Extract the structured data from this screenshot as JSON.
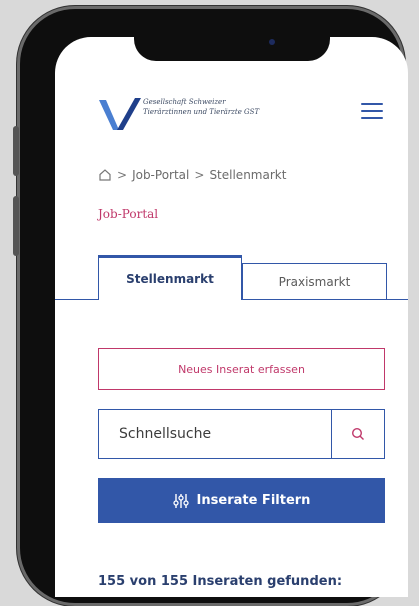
{
  "header": {
    "org_line1": "Gesellschaft Schweizer",
    "org_line2": "Tierärztinnen und Tierärzte GST",
    "logo_icon": "gst-v-logo",
    "menu_icon": "hamburger-menu-icon"
  },
  "breadcrumb": {
    "home_icon": "home-icon",
    "sep": ">",
    "items": [
      "Job-Portal",
      "Stellenmarkt"
    ]
  },
  "page_title": "Job-Portal",
  "tabs": [
    {
      "label": "Stellenmarkt",
      "active": true
    },
    {
      "label": "Praxismarkt",
      "active": false
    }
  ],
  "actions": {
    "new_listing_label": "Neues Inserat erfassen",
    "search_placeholder": "Schnellsuche",
    "filter_label": "Inserate Filtern"
  },
  "results_text": "155 von 155 Inseraten gefunden:",
  "colors": {
    "primary_blue": "#3257a8",
    "accent_pink": "#c0386a"
  }
}
